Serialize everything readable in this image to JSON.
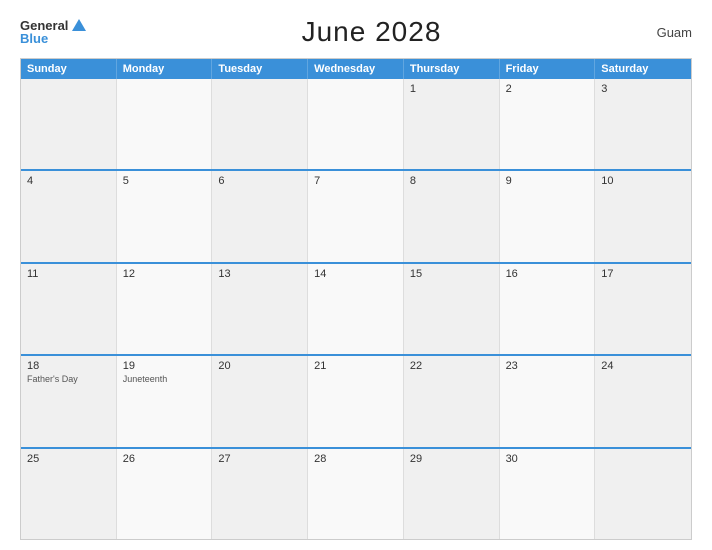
{
  "header": {
    "logo_general": "General",
    "logo_blue": "Blue",
    "title": "June 2028",
    "region": "Guam"
  },
  "calendar": {
    "days_of_week": [
      "Sunday",
      "Monday",
      "Tuesday",
      "Wednesday",
      "Thursday",
      "Friday",
      "Saturday"
    ],
    "weeks": [
      [
        {
          "day": "",
          "holiday": ""
        },
        {
          "day": "",
          "holiday": ""
        },
        {
          "day": "",
          "holiday": ""
        },
        {
          "day": "",
          "holiday": ""
        },
        {
          "day": "1",
          "holiday": ""
        },
        {
          "day": "2",
          "holiday": ""
        },
        {
          "day": "3",
          "holiday": ""
        }
      ],
      [
        {
          "day": "4",
          "holiday": ""
        },
        {
          "day": "5",
          "holiday": ""
        },
        {
          "day": "6",
          "holiday": ""
        },
        {
          "day": "7",
          "holiday": ""
        },
        {
          "day": "8",
          "holiday": ""
        },
        {
          "day": "9",
          "holiday": ""
        },
        {
          "day": "10",
          "holiday": ""
        }
      ],
      [
        {
          "day": "11",
          "holiday": ""
        },
        {
          "day": "12",
          "holiday": ""
        },
        {
          "day": "13",
          "holiday": ""
        },
        {
          "day": "14",
          "holiday": ""
        },
        {
          "day": "15",
          "holiday": ""
        },
        {
          "day": "16",
          "holiday": ""
        },
        {
          "day": "17",
          "holiday": ""
        }
      ],
      [
        {
          "day": "18",
          "holiday": "Father's Day"
        },
        {
          "day": "19",
          "holiday": "Juneteenth"
        },
        {
          "day": "20",
          "holiday": ""
        },
        {
          "day": "21",
          "holiday": ""
        },
        {
          "day": "22",
          "holiday": ""
        },
        {
          "day": "23",
          "holiday": ""
        },
        {
          "day": "24",
          "holiday": ""
        }
      ],
      [
        {
          "day": "25",
          "holiday": ""
        },
        {
          "day": "26",
          "holiday": ""
        },
        {
          "day": "27",
          "holiday": ""
        },
        {
          "day": "28",
          "holiday": ""
        },
        {
          "day": "29",
          "holiday": ""
        },
        {
          "day": "30",
          "holiday": ""
        },
        {
          "day": "",
          "holiday": ""
        }
      ]
    ]
  }
}
